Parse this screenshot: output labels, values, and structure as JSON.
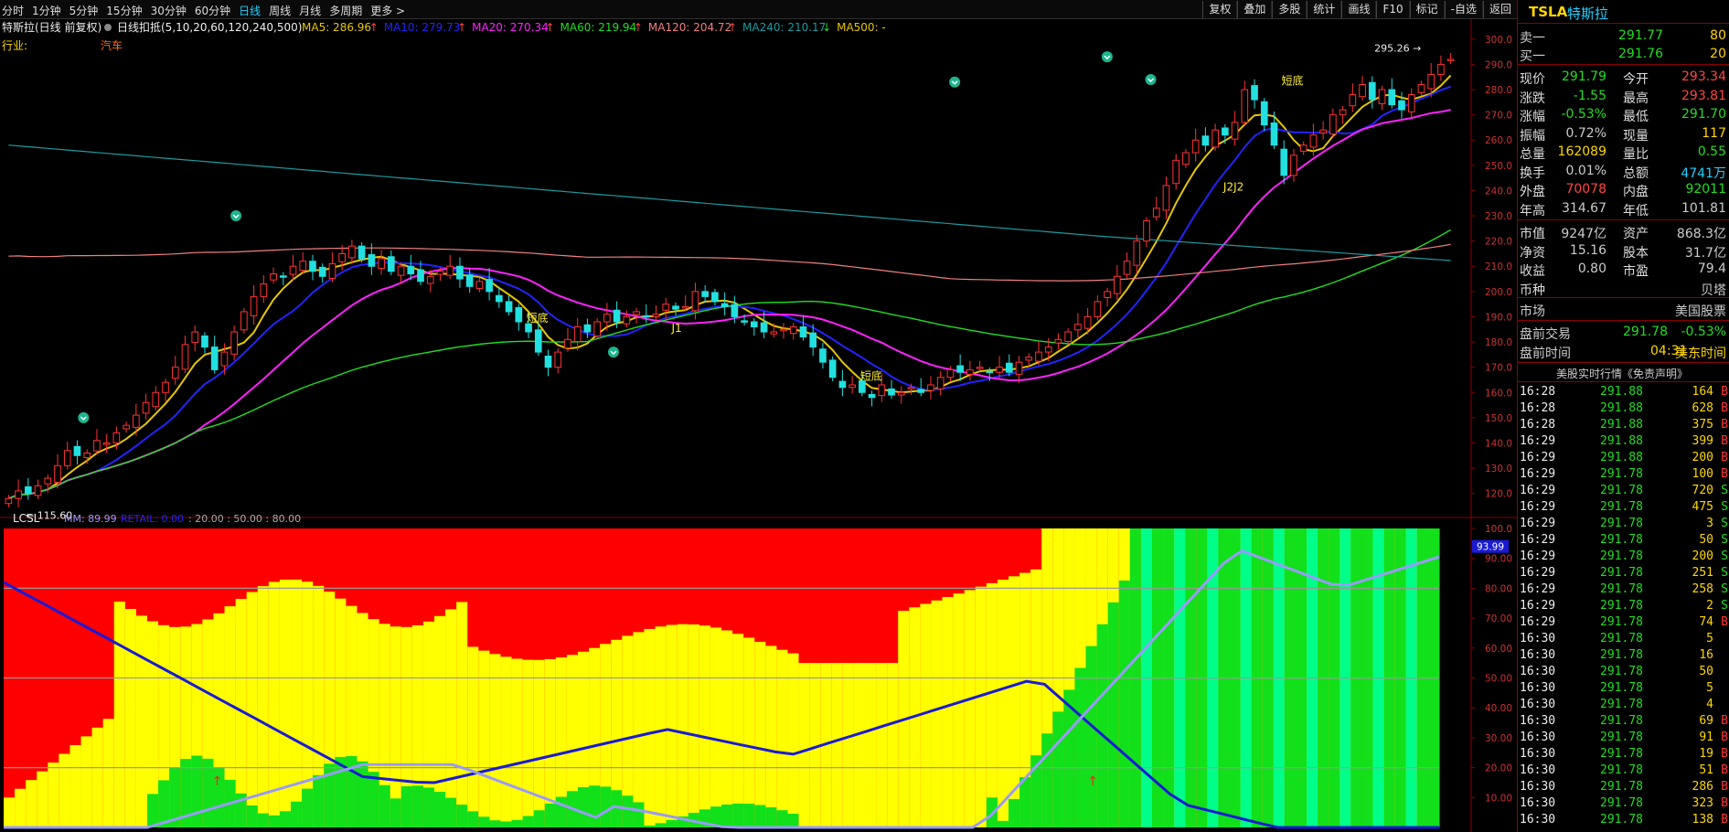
{
  "period_tabs": [
    "分时",
    "1分钟",
    "5分钟",
    "15分钟",
    "30分钟",
    "60分钟",
    "日线",
    "周线",
    "月线",
    "多周期",
    "更多 >"
  ],
  "active_tab": "日线",
  "toolbar": [
    "复权",
    "叠加",
    "多股",
    "统计",
    "画线",
    "F10",
    "标记",
    "-自选",
    "返回"
  ],
  "chart": {
    "stock_name": "特斯拉(日线 前复权)",
    "ma_legend_prefix": "日线扣抵(5,10,20,60,120,240,500)",
    "ma_items": [
      {
        "text": "MA5: 286.96",
        "arrow": "↑",
        "color": "#e5c600"
      },
      {
        "text": "MA10: 279.73",
        "arrow": "↑",
        "color": "#2323ff"
      },
      {
        "text": "MA20: 270.34",
        "arrow": "↑",
        "color": "#ff22ff"
      },
      {
        "text": "MA60: 219.94",
        "arrow": "↑",
        "color": "#22dd22"
      },
      {
        "text": "MA120: 204.72",
        "arrow": "↑",
        "color": "#f08080"
      },
      {
        "text": "MA240: 210.17",
        "arrow": "↓",
        "color": "#1e9aa0"
      },
      {
        "text": "MA500: -",
        "arrow": "",
        "color": "#e5c600"
      }
    ],
    "industry_label": "行业:",
    "industry_value": "汽车",
    "y_ticks": [
      "300.0",
      "290.0",
      "280.0",
      "270.0",
      "260.0",
      "250.0",
      "240.0",
      "230.0",
      "220.0",
      "210.0",
      "200.0",
      "190.0",
      "180.0",
      "170.0",
      "160.0",
      "150.0",
      "140.0",
      "130.0",
      "120.0"
    ],
    "high_label": "295.26",
    "low_label": "115.60",
    "annotations": [
      "短底",
      "J1",
      "短底",
      "短底",
      "J2J2"
    ],
    "indicator_name": "LCSL",
    "indicator_mm": "MM: 89.99",
    "indicator_retail": "RETAIL: 0.00",
    "indicator_levels": ": 20.00 : 50.00 : 80.00",
    "indicator_ticks": [
      "100.0",
      "90.00",
      "80.00",
      "70.00",
      "60.00",
      "50.00",
      "40.00",
      "30.00",
      "20.00",
      "10.00"
    ],
    "indicator_current": "93.99"
  },
  "chart_data": {
    "type": "candlestick",
    "ylim": [
      113,
      305
    ],
    "closes": [
      118,
      121,
      120,
      123,
      126,
      131,
      137,
      135,
      136,
      141,
      140,
      144,
      147,
      151,
      156,
      160,
      164,
      170,
      179,
      184,
      178,
      169,
      176,
      184,
      192,
      198,
      203,
      207,
      206,
      210,
      212,
      208,
      206,
      211,
      215,
      218,
      213,
      210,
      213,
      208,
      210,
      207,
      204,
      206,
      208,
      210,
      205,
      202,
      204,
      200,
      196,
      192,
      188,
      184,
      176,
      170,
      176,
      181,
      186,
      184,
      188,
      191,
      188,
      190,
      192,
      190,
      191,
      195,
      193,
      194,
      200,
      198,
      196,
      194,
      190,
      188,
      186,
      184,
      184,
      185,
      186,
      182,
      178,
      172,
      166,
      162,
      163,
      160,
      158,
      163,
      159,
      160,
      162,
      160,
      163,
      166,
      169,
      168,
      169,
      170,
      168,
      170,
      168,
      172,
      174,
      176,
      178,
      181,
      184,
      187,
      190,
      196,
      200,
      206,
      212,
      220,
      228,
      233,
      242,
      252,
      255,
      260,
      258,
      264,
      262,
      267,
      280,
      276,
      266,
      258,
      246,
      254,
      258,
      262,
      264,
      270,
      272,
      278,
      282,
      276,
      280,
      274,
      272,
      278,
      282,
      286,
      290,
      292
    ],
    "indicator": {
      "levels": [
        20,
        50,
        80
      ],
      "mm": 89.99,
      "retail": 0.0
    }
  },
  "quote": {
    "ticker": "TSLA",
    "name": "特斯拉",
    "sell1": {
      "label": "卖一",
      "price": "291.77",
      "vol": "80"
    },
    "buy1": {
      "label": "买一",
      "price": "291.76",
      "vol": "20"
    },
    "stats": [
      [
        "现价",
        "291.79",
        "今开",
        "293.34"
      ],
      [
        "涨跌",
        "-1.55",
        "最高",
        "293.81"
      ],
      [
        "涨幅",
        "-0.53%",
        "最低",
        "291.70"
      ],
      [
        "振幅",
        "0.72%",
        "现量",
        "117"
      ],
      [
        "总量",
        "162089",
        "量比",
        "0.55"
      ],
      [
        "换手",
        "0.01%",
        "总额",
        "4741万"
      ],
      [
        "外盘",
        "70078",
        "内盘",
        "92011"
      ],
      [
        "年高",
        "314.67",
        "年低",
        "101.81"
      ]
    ],
    "fundamentals": [
      [
        "市值",
        "9247亿",
        "资产",
        "868.3亿"
      ],
      [
        "净资",
        "15.16",
        "股本",
        "31.7亿"
      ],
      [
        "收益",
        "0.80",
        "市盈",
        "79.4"
      ],
      [
        "币种",
        "",
        "",
        "贝塔"
      ]
    ],
    "market_label": "市场",
    "market_value": "美国股票",
    "premarket_label": "盘前交易",
    "premarket_price": "291.78",
    "premarket_pct": "-0.53%",
    "premarket_time_label": "盘前时间",
    "premarket_time": "04:31",
    "premarket_zone": "美东时间",
    "realtime_title": "美股实时行情《免责声明》"
  },
  "trades": [
    [
      "16:28",
      "291.88",
      "164",
      "B"
    ],
    [
      "16:28",
      "291.88",
      "628",
      "B"
    ],
    [
      "16:28",
      "291.88",
      "375",
      "B"
    ],
    [
      "16:29",
      "291.88",
      "399",
      "B"
    ],
    [
      "16:29",
      "291.88",
      "200",
      "B"
    ],
    [
      "16:29",
      "291.78",
      "100",
      "B"
    ],
    [
      "16:29",
      "291.78",
      "720",
      "S"
    ],
    [
      "16:29",
      "291.78",
      "475",
      "S"
    ],
    [
      "16:29",
      "291.78",
      "3",
      "S"
    ],
    [
      "16:29",
      "291.78",
      "50",
      "S"
    ],
    [
      "16:29",
      "291.78",
      "200",
      "S"
    ],
    [
      "16:29",
      "291.78",
      "251",
      "S"
    ],
    [
      "16:29",
      "291.78",
      "258",
      "S"
    ],
    [
      "16:29",
      "291.78",
      "2",
      "S"
    ],
    [
      "16:29",
      "291.78",
      "74",
      "B"
    ],
    [
      "16:30",
      "291.78",
      "5",
      ""
    ],
    [
      "16:30",
      "291.78",
      "16",
      ""
    ],
    [
      "16:30",
      "291.78",
      "50",
      ""
    ],
    [
      "16:30",
      "291.78",
      "5",
      ""
    ],
    [
      "16:30",
      "291.78",
      "4",
      ""
    ],
    [
      "16:30",
      "291.78",
      "69",
      "B"
    ],
    [
      "16:30",
      "291.78",
      "91",
      "B"
    ],
    [
      "16:30",
      "291.78",
      "19",
      "B"
    ],
    [
      "16:30",
      "291.78",
      "51",
      "B"
    ],
    [
      "16:30",
      "291.78",
      "286",
      "B"
    ],
    [
      "16:30",
      "291.78",
      "323",
      "B"
    ],
    [
      "16:30",
      "291.78",
      "138",
      "B"
    ]
  ]
}
